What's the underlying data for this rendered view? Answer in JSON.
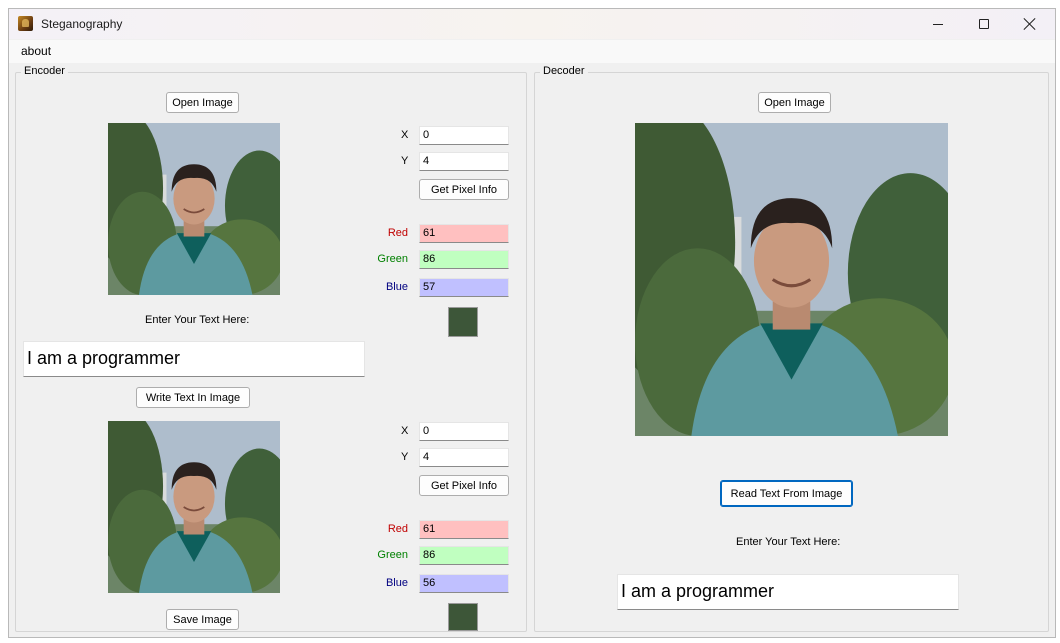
{
  "window": {
    "title": "Steganography",
    "icon": "app-image-icon"
  },
  "menu": {
    "items": [
      "about"
    ]
  },
  "encoder": {
    "title": "Encoder",
    "open_button": "Open Image",
    "top_pixel": {
      "x_label": "X",
      "x_value": "0",
      "y_label": "Y",
      "y_value": "4",
      "button": "Get Pixel Info",
      "red_label": "Red",
      "red_value": "61",
      "green_label": "Green",
      "green_value": "86",
      "blue_label": "Blue",
      "blue_value": "57",
      "swatch_color": "#3d5639"
    },
    "text_label": "Enter Your Text Here:",
    "text_value": "I am a programmer",
    "write_button": "Write Text In Image",
    "bottom_pixel": {
      "x_label": "X",
      "x_value": "0",
      "y_label": "Y",
      "y_value": "4",
      "button": "Get Pixel Info",
      "red_label": "Red",
      "red_value": "61",
      "green_label": "Green",
      "green_value": "86",
      "blue_label": "Blue",
      "blue_value": "56",
      "swatch_color": "#3d5638"
    },
    "save_button": "Save Image"
  },
  "decoder": {
    "title": "Decoder",
    "open_button": "Open Image",
    "read_button": "Read Text From Image",
    "text_label": "Enter Your Text Here:",
    "text_value": "I am a programmer"
  },
  "colors": {
    "red_label": "#c00000",
    "green_label": "#008000",
    "blue_label": "#000080",
    "focus_blue": "#0067c0"
  }
}
